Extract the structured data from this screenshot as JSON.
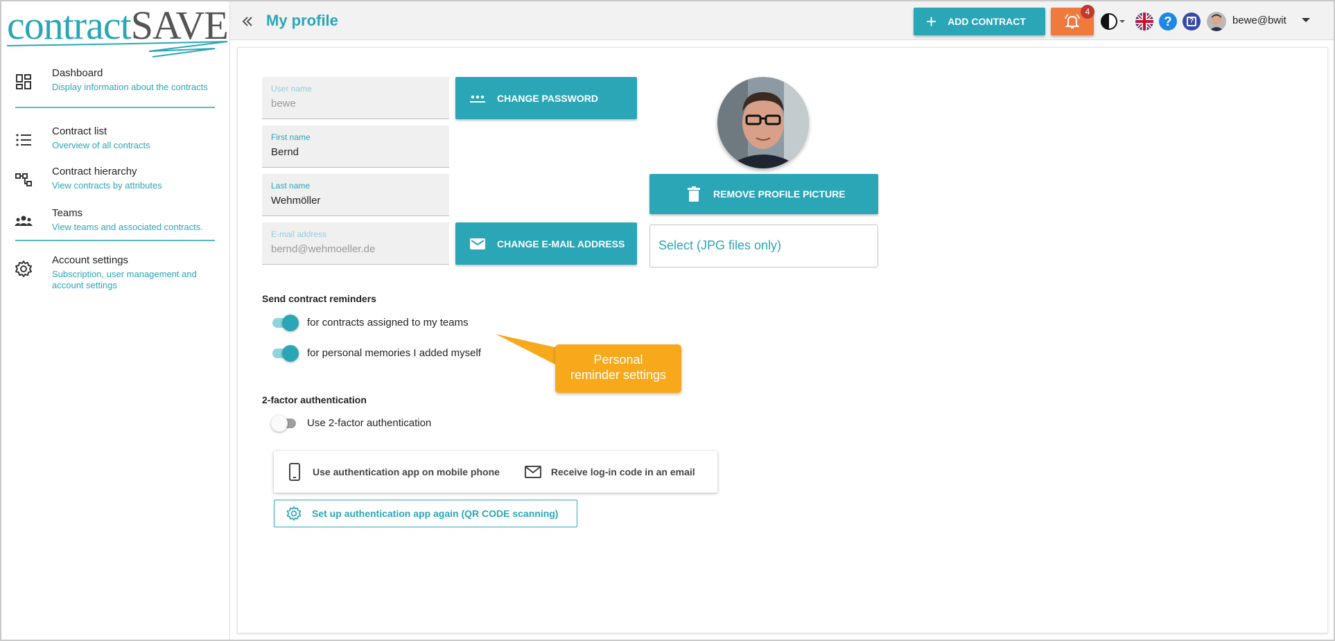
{
  "brand": {
    "logo_part1": "contract",
    "logo_part2": "SAVE",
    "accent": "#2aa6b7"
  },
  "sidebar": {
    "items": [
      {
        "label": "Dashboard",
        "sub": "Display information about the contracts",
        "icon": "dashboard-icon"
      },
      {
        "label": "Contract list",
        "sub": "Overview of all contracts",
        "icon": "list-icon"
      },
      {
        "label": "Contract hierarchy",
        "sub": "View contracts by attributes",
        "icon": "hierarchy-icon"
      },
      {
        "label": "Teams",
        "sub": "View teams and associated contracts.",
        "icon": "teams-icon"
      },
      {
        "label": "Account settings",
        "sub": "Subscription, user management and account settings",
        "icon": "gear-icon"
      }
    ]
  },
  "header": {
    "title": "My profile",
    "add_contract": "ADD CONTRACT",
    "notification_count": "4",
    "help": "?",
    "help2": "?",
    "user": "bewe@bwit"
  },
  "profile": {
    "username_label": "User name",
    "username_value": "bewe",
    "firstname_label": "First name",
    "firstname_value": "Bernd",
    "lastname_label": "Last name",
    "lastname_value": "Wehmöller",
    "email_label": "E-mail address",
    "email_value": "bernd@wehmoeller.de",
    "change_password": "CHANGE PASSWORD",
    "change_email": "CHANGE E-MAIL ADDRESS",
    "remove_picture": "REMOVE PROFILE PICTURE",
    "file_select": "Select (JPG files only)"
  },
  "reminders": {
    "title": "Send contract reminders",
    "teams_label": "for contracts assigned to my teams",
    "teams_on": true,
    "personal_label": "for personal memories I added myself",
    "personal_on": true
  },
  "callout": {
    "line1": "Personal",
    "line2": "reminder settings"
  },
  "two_factor": {
    "title": "2-factor authentication",
    "toggle_label": "Use 2-factor authentication",
    "enabled": false,
    "option_app": "Use authentication app on mobile phone",
    "option_email": "Receive log-in code in an email",
    "setup_again": "Set up authentication app again (QR CODE scanning)"
  }
}
